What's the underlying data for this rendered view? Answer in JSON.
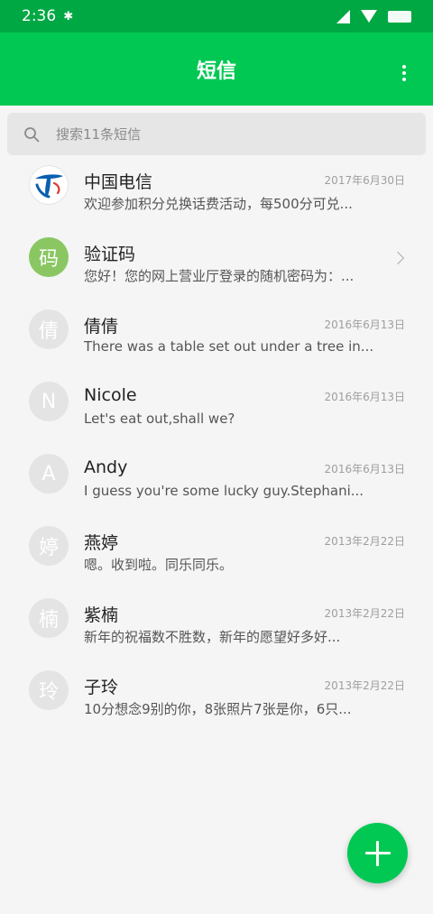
{
  "status_bar": {
    "time": "2:36",
    "bluetooth_icon": "bluetooth-icon"
  },
  "app_bar": {
    "title": "短信",
    "menu_icon": "more-vert-icon"
  },
  "search": {
    "placeholder": "搜索11条短信",
    "icon": "search-icon"
  },
  "colors": {
    "primary": "#00c853",
    "status": "#00a844",
    "avatar_default": "#e4e4e4",
    "avatar_green": "#8ac763"
  },
  "conversations": [
    {
      "name": "中国电信",
      "preview": "欢迎参加积分兑换话费活动，每500分可兑...",
      "date": "2017年6月30日",
      "avatar": ""
    },
    {
      "name": "验证码",
      "preview": "您好！您的网上营业厅登录的随机密码为：...",
      "date": "",
      "avatar": "码"
    },
    {
      "name": "倩倩",
      "preview": "There was a table set out under a tree in...",
      "date": "2016年6月13日",
      "avatar": "倩"
    },
    {
      "name": "Nicole",
      "preview": "Let's eat out,shall we?",
      "date": "2016年6月13日",
      "avatar": "N"
    },
    {
      "name": "Andy",
      "preview": "I guess you're some lucky guy.Stephani...",
      "date": "2016年6月13日",
      "avatar": "A"
    },
    {
      "name": "燕婷",
      "preview": "嗯。收到啦。同乐同乐。",
      "date": "2013年2月22日",
      "avatar": "婷"
    },
    {
      "name": "紫楠",
      "preview": "新年的祝福数不胜数，新年的愿望好多好...",
      "date": "2013年2月22日",
      "avatar": "楠"
    },
    {
      "name": "子玲",
      "preview": "10分想念9别的你，8张照片7张是你，6只...",
      "date": "2013年2月22日",
      "avatar": "玲"
    }
  ],
  "fab": {
    "icon": "plus-icon"
  }
}
